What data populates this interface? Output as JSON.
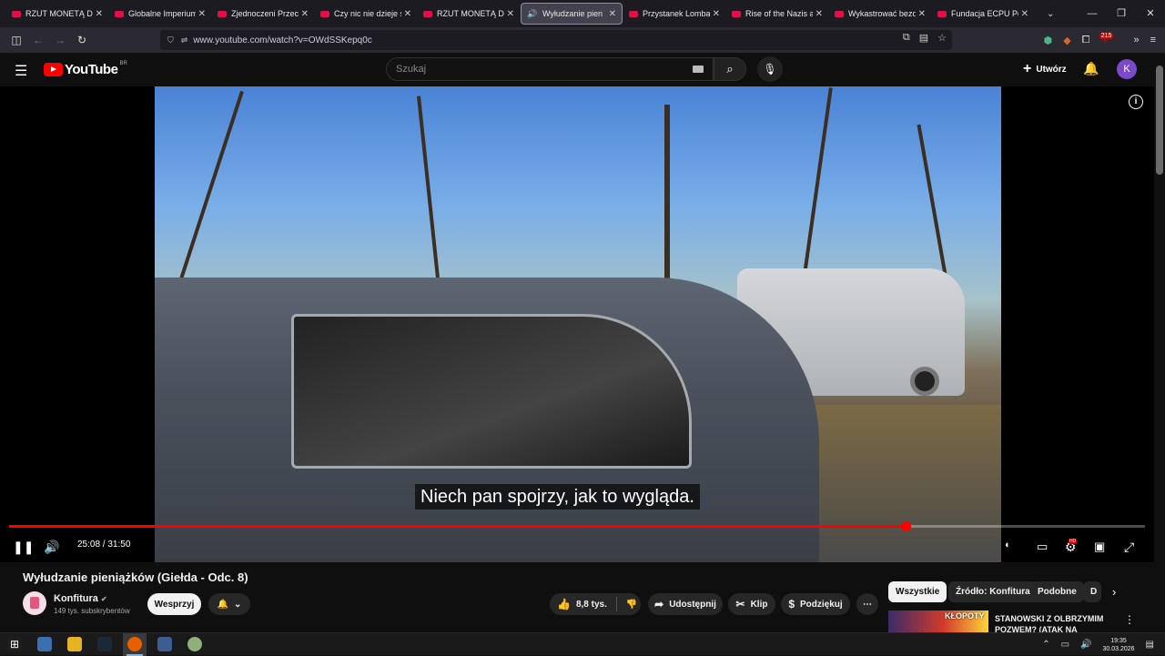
{
  "browser": {
    "tabs": [
      {
        "label": "RZUT MONETĄ DECY",
        "active": false
      },
      {
        "label": "Globalne Imperium B",
        "active": false
      },
      {
        "label": "Zjednoczeni Przeciw",
        "active": false
      },
      {
        "label": "Czy nic nie dzieje się",
        "active": false
      },
      {
        "label": "RZUT MONETĄ DECY",
        "active": false
      },
      {
        "label": "Wyłudzanie pien",
        "active": true
      },
      {
        "label": "Przystanek Lombard",
        "active": false
      },
      {
        "label": "Rise of the Nazis and",
        "active": false
      },
      {
        "label": "Wykastrować bezdom",
        "active": false
      },
      {
        "label": "Fundacja ECPU Polsk",
        "active": false
      }
    ],
    "url": "www.youtube.com/watch?v=OWdSSKepq0c",
    "extension_badge": "215"
  },
  "youtube": {
    "logo_text": "YouTube",
    "logo_country": "BR",
    "search_placeholder": "Szukaj",
    "create_label": "Utwórz",
    "avatar_letter": "K"
  },
  "player": {
    "subtitle": "Niech pan spojrzy, jak to wygląda.",
    "time_current": "25:08",
    "time_total": "31:50",
    "progress_fraction": 0.7896,
    "hd_badge": "HD"
  },
  "video": {
    "title": "Wyłudzanie pieniążków (Giełda - Odc. 8)",
    "channel_name": "Konfitura",
    "subscribers": "149 tys. subskrybentów",
    "support_label": "Wesprzyj",
    "likes": "8,8 tys.",
    "share_label": "Udostępnij",
    "clip_label": "Klip",
    "thanks_label": "Podziękuj"
  },
  "sidebar": {
    "chips": [
      "Wszystkie",
      "Źródło: Konfitura",
      "Podobne",
      "D"
    ],
    "rec_thumb_text": "KŁOPOTY",
    "rec_title": "STANOWSKI Z OLBRZYMIM POZWEM? (ATAK NA"
  },
  "taskbar": {
    "time": "19:35",
    "date": "30.03.2026"
  }
}
